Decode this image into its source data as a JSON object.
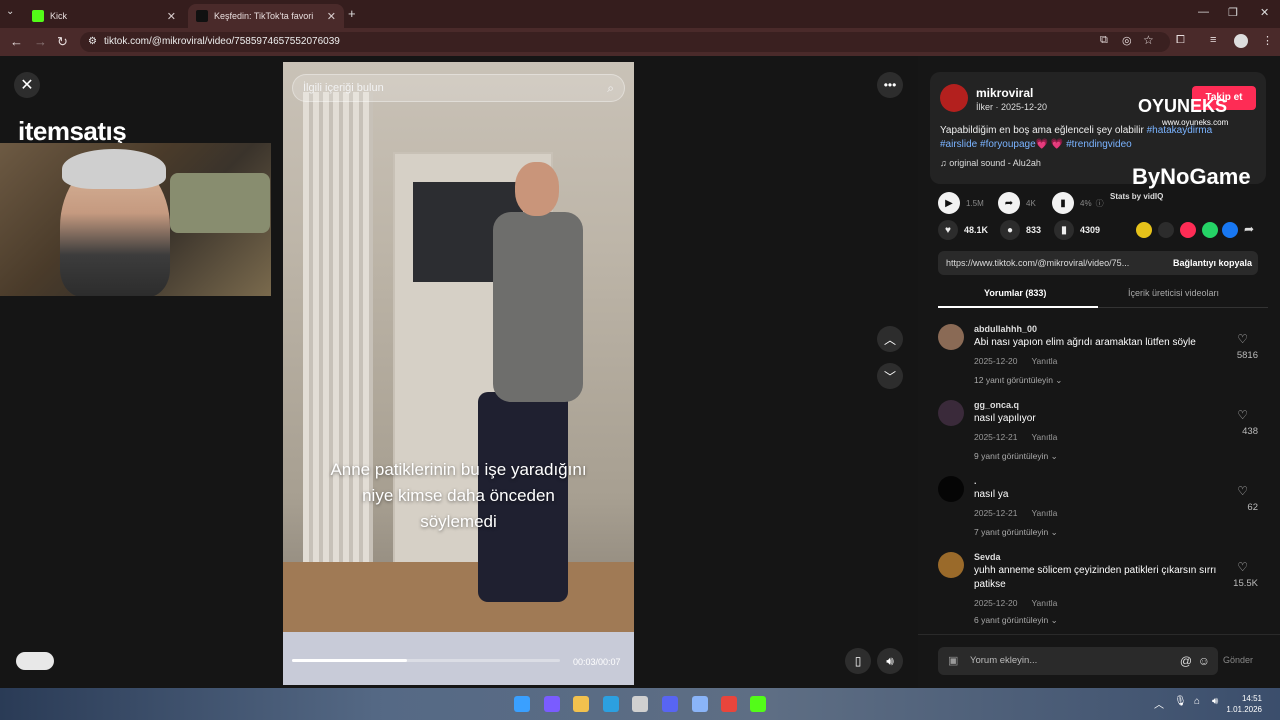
{
  "browser": {
    "tabs": [
      {
        "label": "Kick",
        "active": false
      },
      {
        "label": "Keşfedin: TikTok'ta favori vi",
        "active": true
      }
    ],
    "url": "tiktok.com/@mikroviral/video/7585974657552076039"
  },
  "overlay": {
    "itemsatis_logo": "itemsatış",
    "oyuneks_logo": "OYUNEKS",
    "oyuneks_sub": "www.oyuneks.com",
    "bynogame_logo": "ByNoGame"
  },
  "video": {
    "search_placeholder": "İlgili içeriği bulun",
    "caption": "Anne patiklerinin bu işe yaradığını niye kimse daha önceden söylemedi",
    "time": "00:03/00:07",
    "progress": 0.43
  },
  "author": {
    "username": "mikroviral",
    "nickname_date": "İlker · 2025-12-20",
    "follow_label": "Takip et",
    "desc_text": "Yapabildiğim en boş ama eğlenceli şey olabilir ",
    "desc_tags": [
      "#hatakaydirma",
      "#airslide",
      "#foryoupage💗",
      "💗",
      "#trendingvideo"
    ],
    "sound": "original sound - Alu2ah"
  },
  "stats": {
    "plays": "1.5M",
    "shares": "4K",
    "rate": "4%",
    "stats_by": "Stats by vidIQ"
  },
  "actions": {
    "likes": "48.1K",
    "comments": "833",
    "saves": "4309"
  },
  "link": {
    "url": "https://www.tiktok.com/@mikroviral/video/75...",
    "copy_label": "Bağlantıyı kopyala"
  },
  "tabs": {
    "comments": "Yorumlar (833)",
    "creator_videos": "İçerik üreticisi videoları"
  },
  "comments": [
    {
      "user": "abdullahhh_00",
      "text": "Abi nası yapıon elim ağrıdı aramaktan lütfen söyle",
      "date": "2025-12-20",
      "reply": "Yanıtla",
      "likes": "5816",
      "more": "12 yanıt görüntüleyin"
    },
    {
      "user": "gg_onca.q",
      "text": "nasıl yapılıyor",
      "date": "2025-12-21",
      "reply": "Yanıtla",
      "likes": "438",
      "more": "9 yanıt görüntüleyin"
    },
    {
      "user": ".",
      "text": "nasıl ya",
      "date": "2025-12-21",
      "reply": "Yanıtla",
      "likes": "62",
      "more": "7 yanıt görüntüleyin"
    },
    {
      "user": "Sevda",
      "text": "yuhh anneme sölicem çeyizinden patikleri çıkarsın sırrı patikse",
      "date": "2025-12-20",
      "reply": "Yanıtla",
      "likes": "15.5K",
      "more": "6 yanıt görüntüleyin"
    }
  ],
  "comment_bar": {
    "placeholder": "Yorum ekleyin...",
    "send": "Gönder"
  },
  "taskbar": {
    "time": "14:51",
    "date": "1.01.2026"
  }
}
